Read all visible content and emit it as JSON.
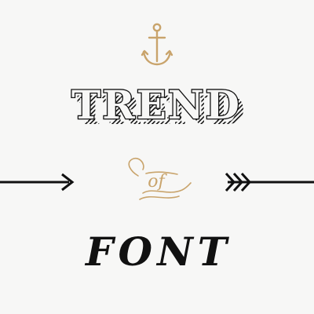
{
  "heading": {
    "line1": "TREND",
    "connector": "of",
    "line2": "FONT"
  },
  "icons": {
    "top": "anchor-icon",
    "left": "arrow-right-icon",
    "right": "arrow-fletched-icon"
  },
  "colors": {
    "background": "#f7f7f6",
    "ink": "#111111",
    "accent": "#c9a46c"
  }
}
